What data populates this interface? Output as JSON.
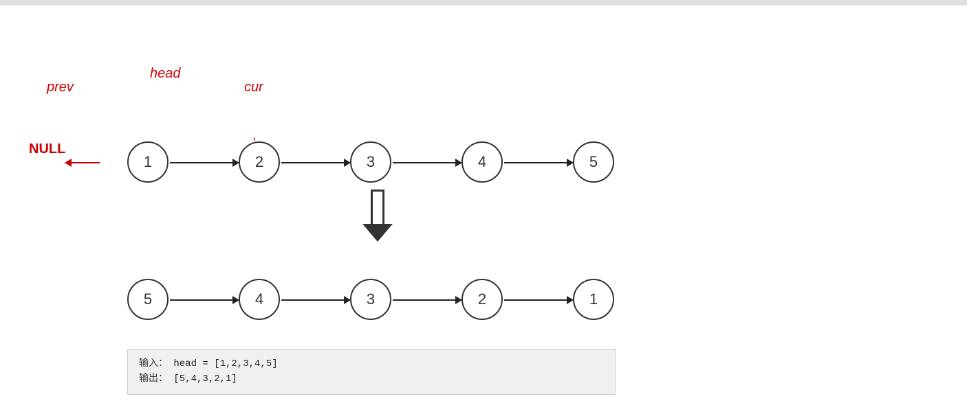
{
  "topbar": {
    "height": 8
  },
  "labels": {
    "prev": "prev",
    "head": "head",
    "cur": "cur",
    "null": "NULL"
  },
  "top_row": {
    "nodes": [
      {
        "id": 1,
        "value": "1"
      },
      {
        "id": 2,
        "value": "2"
      },
      {
        "id": 3,
        "value": "3"
      },
      {
        "id": 4,
        "value": "4"
      },
      {
        "id": 5,
        "value": "5"
      }
    ]
  },
  "bottom_row": {
    "nodes": [
      {
        "id": 1,
        "value": "5"
      },
      {
        "id": 2,
        "value": "4"
      },
      {
        "id": 3,
        "value": "3"
      },
      {
        "id": 4,
        "value": "2"
      },
      {
        "id": 5,
        "value": "1"
      }
    ]
  },
  "code_block": {
    "input_label": "输入：",
    "input_value": "head = [1,2,3,4,5]",
    "output_label": "输出：",
    "output_value": "[5,4,3,2,1]"
  }
}
